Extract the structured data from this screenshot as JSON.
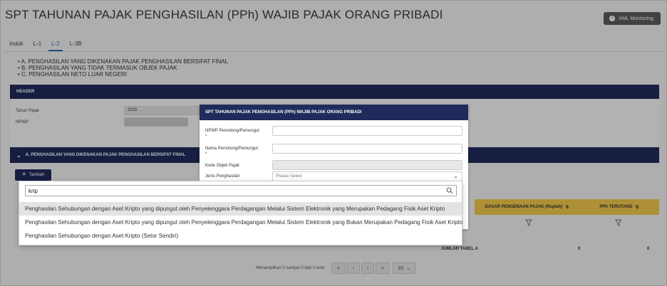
{
  "header": {
    "title": "SPT TAHUNAN PAJAK PENGHASILAN (PPh) WAJIB PAJAK ORANG PRIBADI",
    "xml_button": "XML Monitoring",
    "xml_icon": "info-icon"
  },
  "tabs": [
    {
      "label": "Induk",
      "active": false
    },
    {
      "label": "L-1",
      "active": false
    },
    {
      "label": "L-2",
      "active": true
    },
    {
      "label": "L-3B",
      "active": false
    }
  ],
  "sections_list": [
    "A. PENGHASILAN YANG DIKENAKAN PAJAK PENGHASILAN BERSIFAT FINAL",
    "B. PENGHASILAN YANG TIDAK TERMASUK OBJEK PAJAK",
    "C. PENGHASILAN NETO LUAR NEGERI"
  ],
  "header_section": {
    "title": "HEADER",
    "tahun_pajak_label": "Tahun Pajak",
    "tahun_pajak_value": "2025",
    "npwp_label": "NPWP"
  },
  "section_a": {
    "title": "A. PENGHASILAN YANG DIKENAKAN PAJAK PENGHASILAN BERSIFAT FINAL",
    "add_button": "Tambah",
    "col_dasar": "DASAR PENGENAAN PAJAK (Rupiah)",
    "col_pph": "PPh TERUTANG",
    "jumlah_label": "JUMLAH TABEL A",
    "jumlah_dasar": "0",
    "jumlah_pph": "0",
    "pager_text": "Menampilkan 0 sampai 0 dari 0 entri",
    "page_size": "10",
    "accent": "#1f2b5b",
    "header_yellow": "#f2c94c"
  },
  "modal": {
    "title": "SPT TAHUNAN PAJAK PENGHASILAN (PPh) WAJIB PAJAK ORANG PRIBADI",
    "npwp_label": "NPWP Pemotong/Pemungut",
    "nama_label": "Nama Pemotong/Pemungut",
    "required_mark": "*",
    "kode_label": "Kode Objek Pajak",
    "jenis_label": "Jenis Penghasilan",
    "jenis_placeholder": "Please Select"
  },
  "dropdown": {
    "search_value": "krip",
    "options": [
      "Penghasilan Sehubungan dengan Aset Kripto yang dipungut oleh Penyelenggara Perdagangan Melalui Sistem Elektronik yang Merupakan Pedagang Fisik Aset Kripto",
      "Penghasilan Sehubungan dengan Aset Kripto yang dipungut oleh Penyelenggara Perdagangan Melalui Sistem Elektronik yang Bukan Merupakan Pedagang Fisik Aset Kripto",
      "Penghasilan Sehubungan dengan Aset Kripto (Setor Sendiri)"
    ]
  }
}
